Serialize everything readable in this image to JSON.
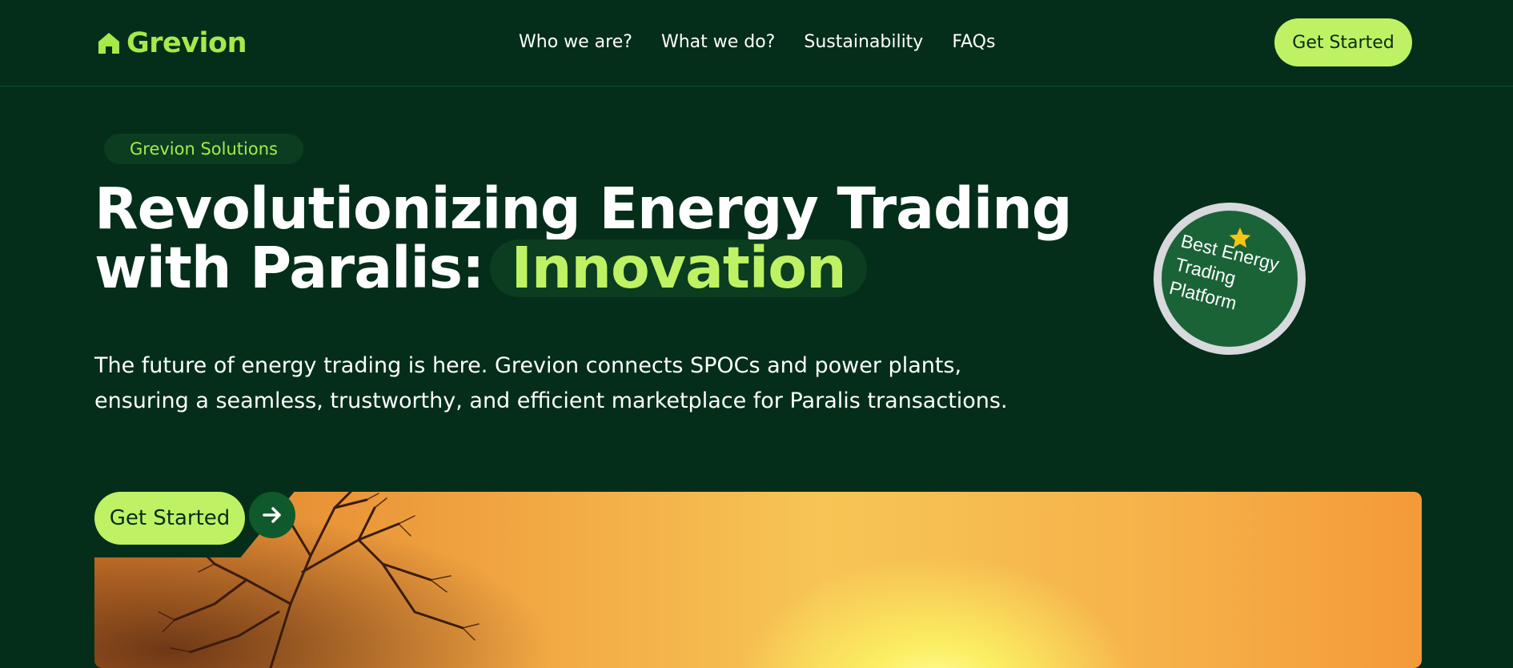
{
  "header": {
    "logo_text": "Grevion",
    "logo_icon": "home-icon",
    "nav": [
      {
        "label": "Who we are?"
      },
      {
        "label": "What we do?"
      },
      {
        "label": "Sustainability"
      },
      {
        "label": "FAQs"
      }
    ],
    "cta_label": "Get Started"
  },
  "hero": {
    "tag": "Grevion Solutions",
    "title_line1": "Revolutionizing Energy Trading",
    "title_line2_prefix": "with Paralis:",
    "title_highlight": "Innovation",
    "description": "The future of energy trading is here. Grevion connects SPOCs and power plants, ensuring a seamless, trustworthy, and efficient marketplace for Paralis transactions.",
    "badge_text": "Best Energy Trading Platform",
    "badge_icon": "star-icon",
    "cta_label": "Get Started",
    "cta_icon": "arrow-right-icon"
  },
  "colors": {
    "background": "#042e1a",
    "accent": "#bef264",
    "logo_green": "#a6ea4a",
    "pill_bg": "#0b3d21",
    "badge_bg": "#1a6337",
    "badge_ring": "#d7d9dc",
    "star": "#f5c518"
  }
}
